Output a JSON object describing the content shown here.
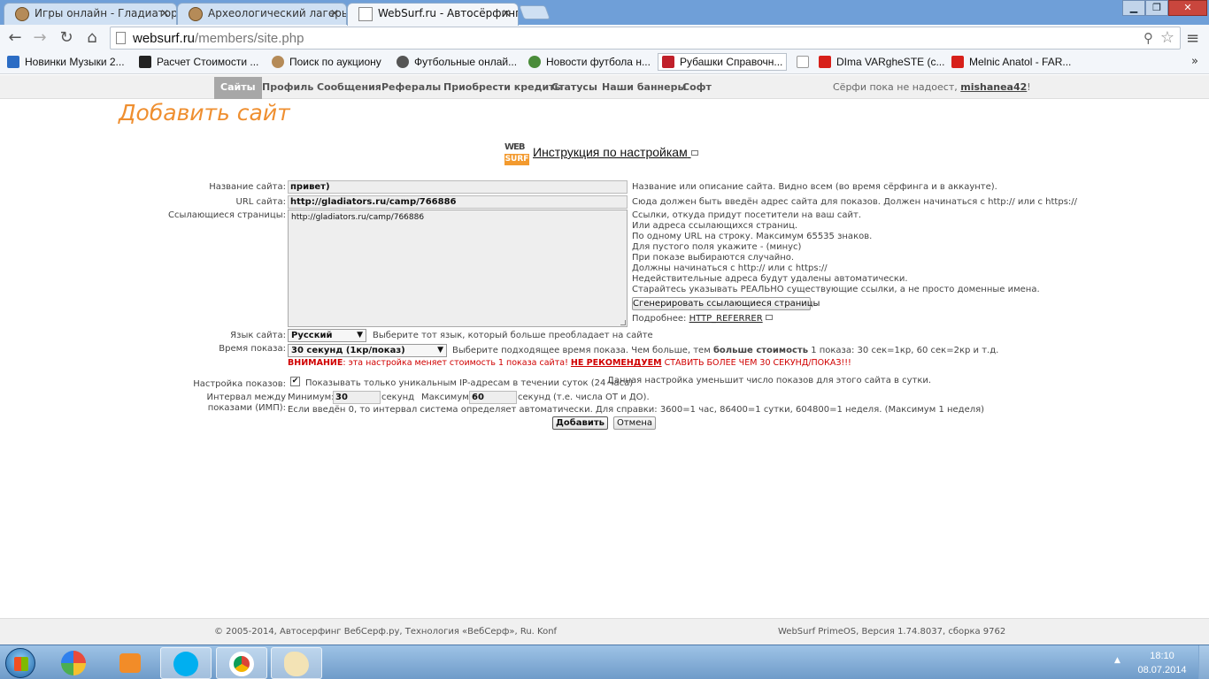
{
  "browser": {
    "tabs": [
      {
        "title": "Игры онлайн - Гладиатор",
        "close": "✕"
      },
      {
        "title": "Археологический лагерь",
        "close": "✕"
      },
      {
        "title": "WebSurf.ru - Автосёрфинг",
        "close": "✕"
      }
    ],
    "window_buttons": {
      "minimize": "▁",
      "maximize": "❐",
      "close": "✕"
    },
    "address": {
      "host": "websurf.ru",
      "path": "/members/site.php"
    },
    "bookmarks": [
      "Новинки Музыки 2...",
      "Расчет Стоимости ...",
      "Поиск по аукциону",
      "Футбольные онлай...",
      "Новости футбола н...",
      "Рубашки Справочн...",
      "",
      "DIma VARgheSTE (с...",
      "Melnic Anatol - FAR..."
    ],
    "bookmarks_more": "»"
  },
  "site_nav": {
    "items": [
      "Сайты",
      "Профиль",
      "Сообщения",
      "Рефералы",
      "Приобрести кредиты",
      "Статусы",
      "Наши баннеры",
      "Софт"
    ],
    "status_text": "Сёрфи пока не надоест, ",
    "username": "mishanea42",
    "status_end": "!"
  },
  "page": {
    "title": "Добавить сайт",
    "logo_top": "WEB",
    "logo_bottom": "SURF",
    "instruction_link": "Инструкция по настройкам"
  },
  "form": {
    "site_name": {
      "label": "Название сайта:",
      "value": "привет)",
      "hint": "Название или описание сайта. Видно всем (во время сёрфинга и в аккаунте)."
    },
    "site_url": {
      "label": "URL сайта:",
      "value": "http://gladiators.ru/camp/766886",
      "hint": "Сюда должен быть введён адрес сайта для показов. Должен начинаться с http:// или с https://"
    },
    "referrers": {
      "label": "Ссылающиеся страницы:",
      "value": "http://gladiators.ru/camp/766886",
      "hints": [
        "Ссылки, откуда придут посетители на ваш сайт.",
        "Или адреса ссылающихся страниц.",
        "По одному URL на строку. Максимум 65535 знаков.",
        "Для пустого поля укажите - (минус)",
        "При показе выбираются случайно.",
        "Должны начинаться с http:// или с https://",
        "Недействительные адреса будут удалены автоматически.",
        "Старайтесь указывать РЕАЛЬНО существующие ссылки, а не просто доменные имена."
      ],
      "generate_button": "Сгенерировать ссылающиеся страницы",
      "more_label": "Подробнее: ",
      "more_link": "HTTP_REFERRER"
    },
    "language": {
      "label": "Язык сайта:",
      "value": "Русский",
      "hint": "Выберите тот язык, который больше преобладает на сайте"
    },
    "show_time": {
      "label": "Время показа:",
      "value": "30 секунд (1кр/показ)",
      "hint_pre": "Выберите подходящее время показа. Чем больше, тем ",
      "hint_bold": "больше стоимость",
      "hint_post": " 1 показа: 30 сек=1кр, 60 сек=2кр и т.д.",
      "warn_1": "ВНИМАНИЕ",
      "warn_2": ": эта настройка меняет стоимость 1 показа сайта! ",
      "warn_3": "НЕ РЕКОМЕНДУЕМ",
      "warn_4": " СТАВИТЬ БОЛЕЕ ЧЕМ 30 СЕКУНД/ПОКАЗ!!!"
    },
    "show_settings": {
      "label": "Настройка показов:",
      "check_mark": "✔",
      "checkbox_label": "Показывать только уникальным IP-адресам в течении суток (24 часа)",
      "hint": "Данная настройка уменьшит число показов для этого сайта в сутки."
    },
    "interval": {
      "label_line1": "Интервал между",
      "label_line2": "показами (ИМП):",
      "min_label": "Минимум:",
      "min_value": "30",
      "min_unit": "секунд",
      "max_label": "Максимум:",
      "max_value": "60",
      "max_unit": "секунд",
      "range_note": "(т.е. числа ОТ и ДО).",
      "hint": "Если введён 0, то интервал система определяет автоматически. Для справки: 3600=1 час, 86400=1 сутки, 604800=1 неделя. (Максимум 1 неделя)"
    },
    "submit_button": "Добавить",
    "cancel_button": "Отмена"
  },
  "footer": {
    "left": "© 2005-2014, Автосерфинг ВебСерф.ру,  Технология «ВебСерф», Ru. Konf",
    "right": "WebSurf PrimeOS, Версия 1.74.8037, сборка 9762"
  },
  "taskbar": {
    "time": "18:10",
    "date": "08.07.2014",
    "tray_up": "▲"
  },
  "colors": {
    "accent_orange": "#ef8f30",
    "warning_red": "#d00000",
    "nav_active": "#a7a7a7"
  }
}
